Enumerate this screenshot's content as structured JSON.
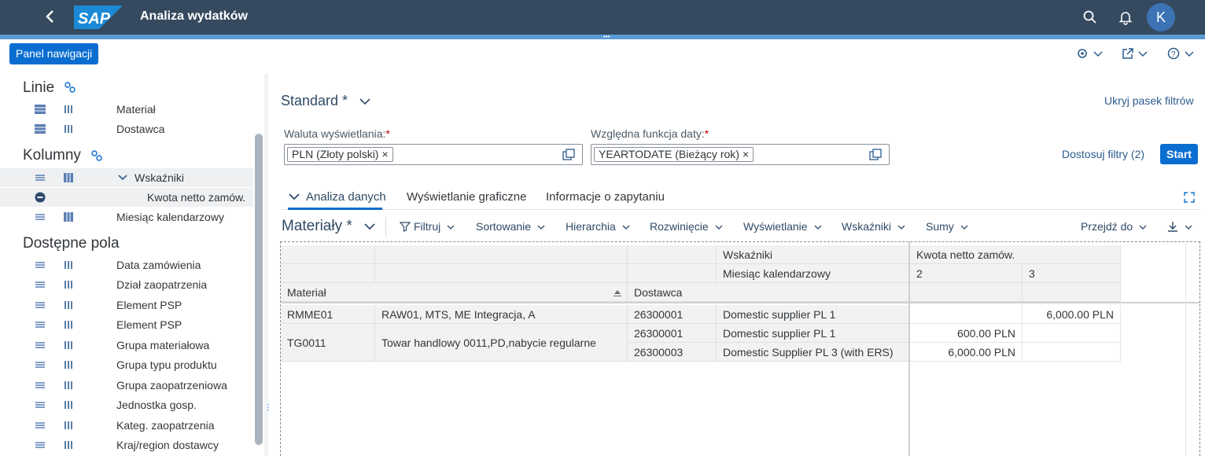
{
  "shell": {
    "title": "Analiza wydatków",
    "logo_text": "SAP",
    "avatar_initial": "K"
  },
  "toolbar": {
    "nav_button": "Panel nawigacji"
  },
  "left_panel": {
    "rows_title": "Linie",
    "rows": [
      "Materiał",
      "Dostawca"
    ],
    "columns_title": "Kolumny",
    "columns_group": "Wskaźniki",
    "columns_subitem": "Kwota netto zamów.",
    "columns_last": "Miesiąc kalendarzowy",
    "available_title": "Dostępne pola",
    "available": [
      "Data zamówienia",
      "Dział zaopatrzenia",
      "Element PSP",
      "Element PSP",
      "Grupa materiałowa",
      "Grupa typu produktu",
      "Grupa zaopatrzeniowa",
      "Jednostka gosp.",
      "Kateg. zaopatrzenia",
      "Kraj/region dostawcy"
    ]
  },
  "filter_bar": {
    "variant": "Standard *",
    "hide_link": "Ukryj pasek filtrów",
    "currency_label": "Waluta wyświetlania:",
    "currency_token": "PLN (Złoty polski)",
    "date_label": "Względna funkcja daty:",
    "date_token": "YEARTODATE (Bieżący rok)",
    "adapt": "Dostosuj filtry (2)",
    "start": "Start",
    "required_mark": "*"
  },
  "tabs": [
    "Analiza danych",
    "Wyświetlanie graficzne",
    "Informacje o zapytaniu"
  ],
  "query": {
    "title": "Materiały *",
    "buttons": [
      "Filtruj",
      "Sortowanie",
      "Hierarchia",
      "Rozwinięcie",
      "Wyświetlanie",
      "Wskaźniki",
      "Sumy"
    ],
    "goto": "Przejdź do"
  },
  "table": {
    "hdr_wskazniki": "Wskaźniki",
    "hdr_kwota": "Kwota netto zamów.",
    "hdr_miesiac": "Miesiąc kalendarzowy",
    "hdr_m2": "2",
    "hdr_m3": "3",
    "hdr_material": "Materiał",
    "hdr_dostawca": "Dostawca",
    "rows": [
      {
        "mat": "RMME01",
        "mat_desc": "RAW01, MTS, ME Integracja, A",
        "sup": "26300001",
        "sup_desc": "Domestic supplier PL 1",
        "m2": "",
        "m3": "6,000.00 PLN"
      },
      {
        "mat": "TG0011",
        "mat_desc": "Towar handlowy 0011,PD,nabycie regularne",
        "sup": "26300001",
        "sup_desc": "Domestic supplier PL 1",
        "m2": "600.00 PLN",
        "m3": ""
      },
      {
        "mat": "",
        "mat_desc": "",
        "sup": "26300003",
        "sup_desc": "Domestic Supplier PL 3 (with ERS)",
        "m2": "6,000.00 PLN",
        "m3": ""
      }
    ]
  }
}
